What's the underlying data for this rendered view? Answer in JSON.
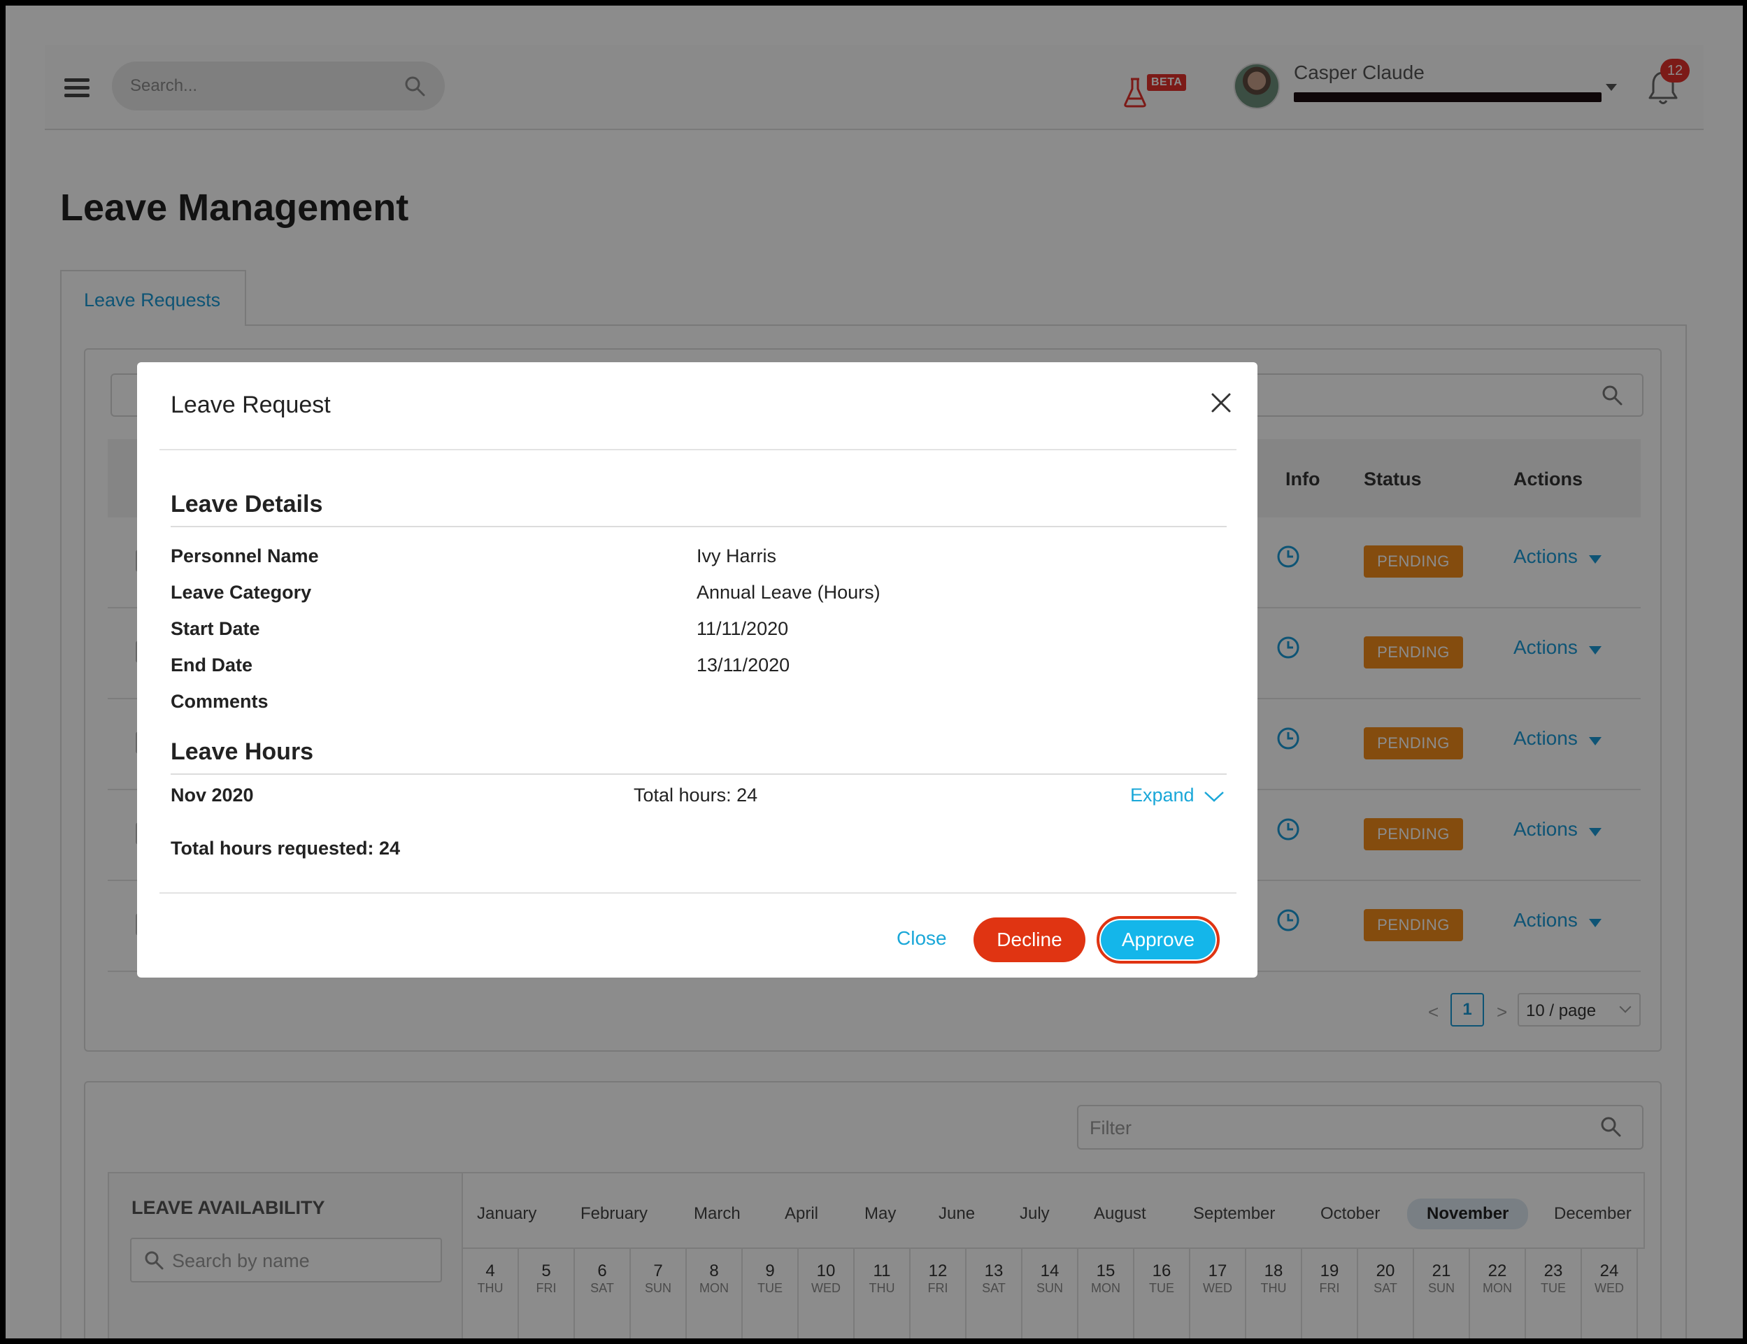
{
  "header": {
    "search_placeholder": "Search...",
    "beta_label": "BETA",
    "user_name": "Casper Claude",
    "notification_count": "12"
  },
  "page": {
    "title": "Leave Management",
    "tab_label": "Leave Requests"
  },
  "table": {
    "headers": {
      "info": "Info",
      "status": "Status",
      "actions": "Actions"
    },
    "rows": [
      {
        "status": "PENDING",
        "action": "Actions"
      },
      {
        "status": "PENDING",
        "action": "Actions"
      },
      {
        "status": "PENDING",
        "action": "Actions"
      },
      {
        "status": "PENDING",
        "action": "Actions"
      },
      {
        "status": "PENDING",
        "action": "Actions"
      }
    ],
    "pagination": {
      "prev": "<",
      "current_page": "1",
      "next": ">",
      "page_size": "10 / page"
    }
  },
  "availability": {
    "filter_placeholder": "Filter",
    "title": "LEAVE AVAILABILITY",
    "search_placeholder": "Search by name",
    "months": [
      "January",
      "February",
      "March",
      "April",
      "May",
      "June",
      "July",
      "August",
      "September",
      "October",
      "November",
      "December"
    ],
    "active_month": "November",
    "days": [
      {
        "num": "4",
        "dow": "THU"
      },
      {
        "num": "5",
        "dow": "FRI"
      },
      {
        "num": "6",
        "dow": "SAT"
      },
      {
        "num": "7",
        "dow": "SUN"
      },
      {
        "num": "8",
        "dow": "MON"
      },
      {
        "num": "9",
        "dow": "TUE"
      },
      {
        "num": "10",
        "dow": "WED"
      },
      {
        "num": "11",
        "dow": "THU"
      },
      {
        "num": "12",
        "dow": "FRI"
      },
      {
        "num": "13",
        "dow": "SAT"
      },
      {
        "num": "14",
        "dow": "SUN"
      },
      {
        "num": "15",
        "dow": "MON"
      },
      {
        "num": "16",
        "dow": "TUE"
      },
      {
        "num": "17",
        "dow": "WED"
      },
      {
        "num": "18",
        "dow": "THU"
      },
      {
        "num": "19",
        "dow": "FRI"
      },
      {
        "num": "20",
        "dow": "SAT"
      },
      {
        "num": "21",
        "dow": "SUN"
      },
      {
        "num": "22",
        "dow": "MON"
      },
      {
        "num": "23",
        "dow": "TUE"
      },
      {
        "num": "24",
        "dow": "WED"
      }
    ]
  },
  "modal": {
    "title": "Leave Request",
    "details_title": "Leave Details",
    "fields": [
      {
        "label": "Personnel Name",
        "value": "Ivy Harris"
      },
      {
        "label": "Leave Category",
        "value": "Annual Leave (Hours)"
      },
      {
        "label": "Start Date",
        "value": "11/11/2020"
      },
      {
        "label": "End Date",
        "value": "13/11/2020"
      },
      {
        "label": "Comments",
        "value": ""
      }
    ],
    "hours_title": "Leave Hours",
    "month_label": "Nov 2020",
    "month_total": "Total hours: 24",
    "expand_label": "Expand",
    "total_requested": "Total hours requested: 24",
    "buttons": {
      "close": "Close",
      "decline": "Decline",
      "approve": "Approve"
    }
  },
  "colors": {
    "accent": "#1aa7d8",
    "pending": "#f08b1a",
    "decline": "#e03412",
    "approve": "#14b6ea"
  }
}
